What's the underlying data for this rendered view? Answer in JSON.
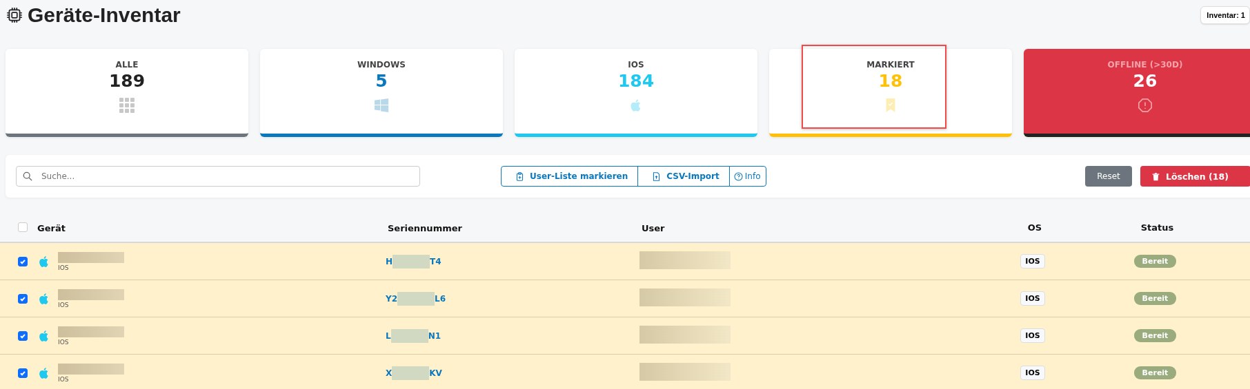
{
  "title": "Geräte-Inventar",
  "inventory_badge": "Inventar: 1",
  "cards": [
    {
      "label": "ALLE",
      "value": "189",
      "kind": "grid",
      "color": "#6c757d",
      "filled": false,
      "highlighted": false
    },
    {
      "label": "WINDOWS",
      "value": "5",
      "kind": "windows",
      "color": "#0a78be",
      "filled": false,
      "highlighted": false
    },
    {
      "label": "IOS",
      "value": "184",
      "kind": "apple",
      "color": "#1ec8ee",
      "filled": false,
      "highlighted": false
    },
    {
      "label": "MARKIERT",
      "value": "18",
      "kind": "bookmark",
      "color": "#ffc107",
      "filled": false,
      "highlighted": true
    },
    {
      "label": "OFFLINE (>30D)",
      "value": "26",
      "kind": "alert",
      "color": "#dc3545",
      "filled": true,
      "highlighted": false
    }
  ],
  "search": {
    "placeholder": "Suche..."
  },
  "actions": [
    {
      "label": "User-Liste markieren",
      "kind": "clipboard"
    },
    {
      "label": "CSV-Import",
      "kind": "upload"
    },
    {
      "label": "Info",
      "kind": "help"
    }
  ],
  "reset": "Reset",
  "delete": "Löschen (18)",
  "table": {
    "select_all": {
      "checked": false
    },
    "columns": [
      "Gerät",
      "Seriennummer",
      "User",
      "OS",
      "Status"
    ],
    "rows": [
      {
        "checked": true,
        "os_sub": "IOS",
        "serial_start": "H",
        "serial_end": "T4",
        "os": "IOS",
        "status": "Bereit"
      },
      {
        "checked": true,
        "os_sub": "IOS",
        "serial_start": "Y2",
        "serial_end": "L6",
        "os": "IOS",
        "status": "Bereit"
      },
      {
        "checked": true,
        "os_sub": "IOS",
        "serial_start": "L",
        "serial_end": "N1",
        "os": "IOS",
        "status": "Bereit"
      },
      {
        "checked": true,
        "os_sub": "IOS",
        "serial_start": "X",
        "serial_end": "KV",
        "os": "IOS",
        "status": "Bereit"
      }
    ]
  }
}
